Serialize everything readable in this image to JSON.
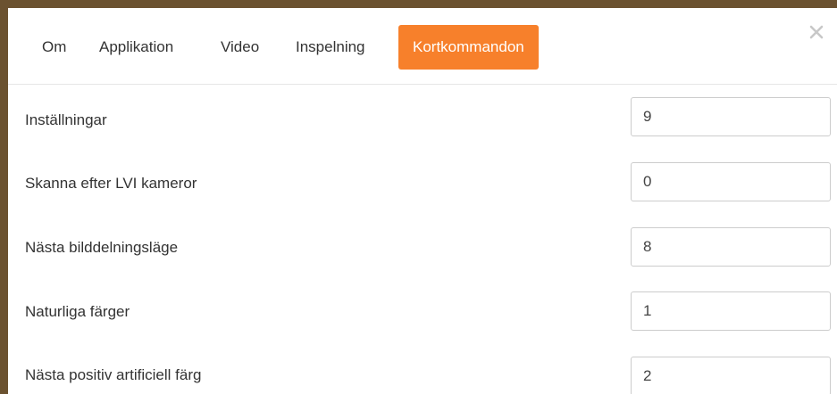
{
  "accent_color": "#f7802b",
  "tabs": [
    {
      "label": "Om"
    },
    {
      "label": "Applikation"
    },
    {
      "label": "Video"
    },
    {
      "label": "Inspelning"
    },
    {
      "label": "Kortkommandon",
      "active": true
    }
  ],
  "close_icon": "close-icon",
  "shortcuts": [
    {
      "label": "Inställningar",
      "value": "9"
    },
    {
      "label": "Skanna efter LVI kameror",
      "value": "0"
    },
    {
      "label": "Nästa bilddelningsläge",
      "value": "8"
    },
    {
      "label": "Naturliga färger",
      "value": "1"
    },
    {
      "label": "Nästa positiv artificiell färg",
      "value": "2"
    }
  ]
}
